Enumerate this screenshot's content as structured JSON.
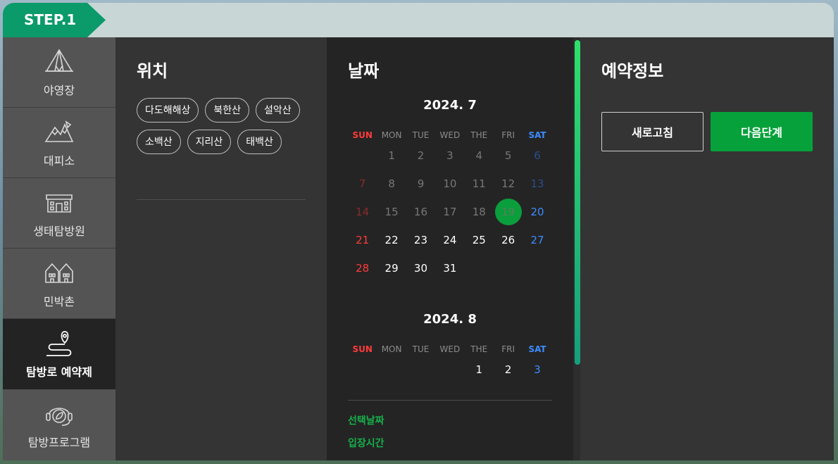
{
  "step_label": "STEP.1",
  "sidebar": {
    "items": [
      {
        "label": "야영장",
        "icon": "tent-icon"
      },
      {
        "label": "대피소",
        "icon": "mountain-icon"
      },
      {
        "label": "생태탐방원",
        "icon": "building-icon"
      },
      {
        "label": "민박촌",
        "icon": "houses-icon"
      },
      {
        "label": "탐방로 예약제",
        "icon": "trail-pin-icon",
        "active": true
      },
      {
        "label": "탐방프로그램",
        "icon": "leaf-headset-icon"
      }
    ]
  },
  "location": {
    "title": "위치",
    "chips": [
      "다도해해상",
      "북한산",
      "설악산",
      "소백산",
      "지리산",
      "태백산"
    ]
  },
  "date": {
    "title": "날짜",
    "weekdays": [
      "SUN",
      "MON",
      "TUE",
      "WED",
      "THE",
      "FRI",
      "SAT"
    ],
    "months": [
      {
        "label": "2024. 7",
        "days": [
          "",
          "1",
          "2",
          "3",
          "4",
          "5",
          "6",
          "7",
          "8",
          "9",
          "10",
          "11",
          "12",
          "13",
          "14",
          "15",
          "16",
          "17",
          "18",
          "19",
          "20",
          "21",
          "22",
          "23",
          "24",
          "25",
          "26",
          "27",
          "28",
          "29",
          "30",
          "31"
        ]
      },
      {
        "label": "2024. 8",
        "days": [
          "",
          "",
          "",
          "",
          "1",
          "2",
          "3"
        ]
      }
    ],
    "selected_label": "선택날짜",
    "entry_time_label": "입장시간"
  },
  "reservation": {
    "title": "예약정보",
    "refresh_label": "새로고침",
    "next_label": "다음단계"
  },
  "colors": {
    "accent_green": "#06a13a",
    "step_green": "#0b9a6a",
    "sunday_red": "#ff3b3b",
    "saturday_blue": "#3d8bff"
  }
}
